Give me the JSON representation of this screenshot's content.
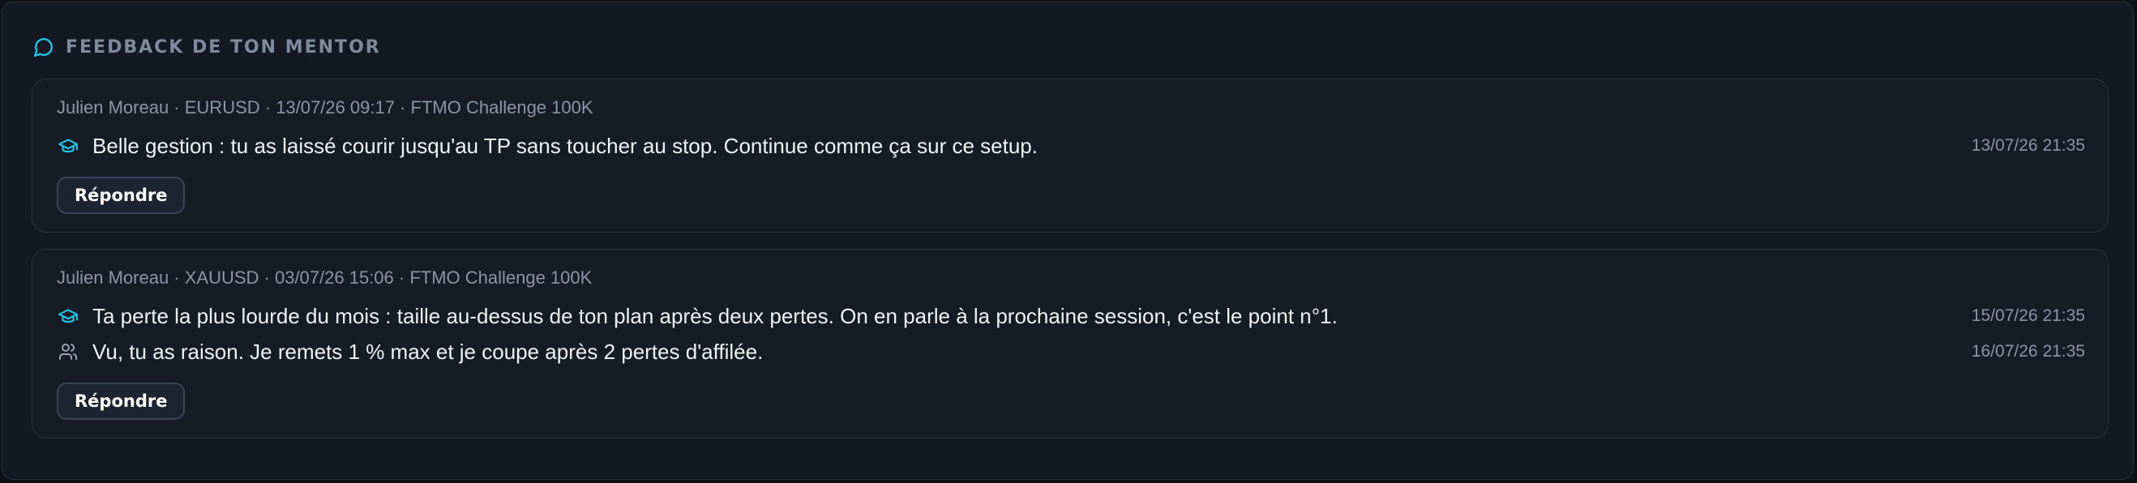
{
  "panel": {
    "title": "FEEDBACK DE TON MENTOR",
    "icon": "chat-bubble-icon",
    "accent_color": "#22c3e6"
  },
  "threads": [
    {
      "meta": "Julien Moreau · EURUSD · 13/07/26 09:17 · FTMO Challenge 100K",
      "messages": [
        {
          "author_icon": "mentor-cap-icon",
          "text": "Belle gestion : tu as laissé courir jusqu'au TP sans toucher au stop. Continue comme ça sur ce setup.",
          "time": "13/07/26 21:35"
        }
      ],
      "reply_label": "Répondre"
    },
    {
      "meta": "Julien Moreau · XAUUSD · 03/07/26 15:06 · FTMO Challenge 100K",
      "messages": [
        {
          "author_icon": "mentor-cap-icon",
          "text": "Ta perte la plus lourde du mois : taille au-dessus de ton plan après deux pertes. On en parle à la prochaine session, c'est le point n°1.",
          "time": "15/07/26 21:35"
        },
        {
          "author_icon": "student-users-icon",
          "text": "Vu, tu as raison. Je remets 1 % max et je coupe après 2 pertes d'affilée.",
          "time": "16/07/26 21:35"
        }
      ],
      "reply_label": "Répondre"
    }
  ]
}
